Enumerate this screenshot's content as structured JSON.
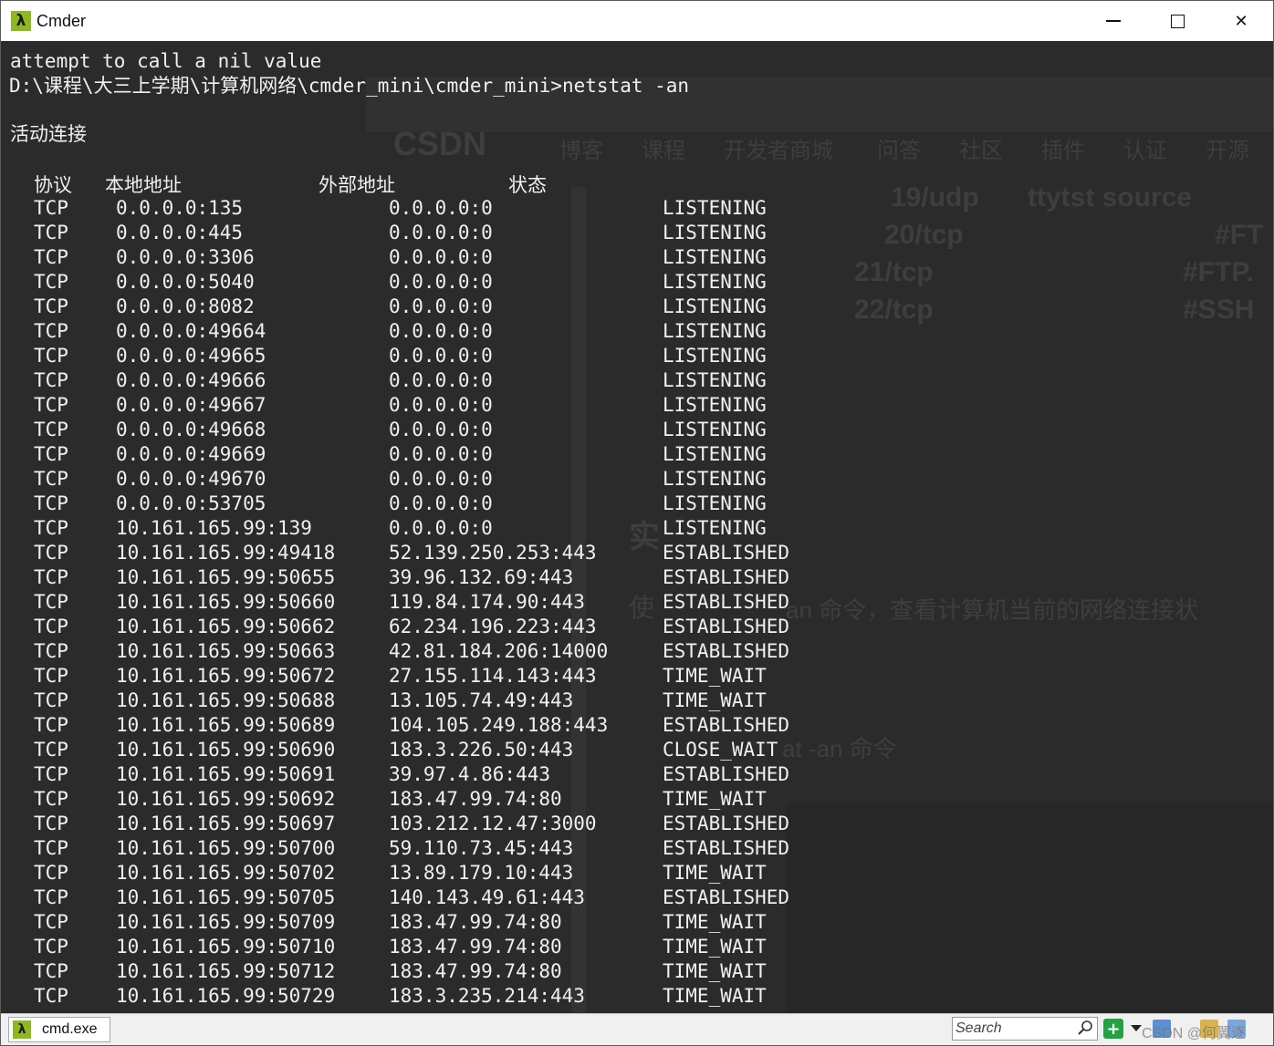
{
  "window": {
    "title": "Cmder",
    "app_icon": "λ",
    "min_icon": "minimize-icon",
    "max_icon": "maximize-icon",
    "close_icon": "close-icon",
    "close_glyph": "✕"
  },
  "terminal": {
    "lines": [
      "attempt to call a nil value",
      "D:\\课程\\大三上学期\\计算机网络\\cmder_mini\\cmder_mini>netstat -an",
      "活动连接"
    ],
    "headers": [
      "协议",
      "本地地址",
      "外部地址",
      "状态"
    ],
    "rows": [
      [
        "TCP",
        "0.0.0.0:135",
        "0.0.0.0:0",
        "LISTENING"
      ],
      [
        "TCP",
        "0.0.0.0:445",
        "0.0.0.0:0",
        "LISTENING"
      ],
      [
        "TCP",
        "0.0.0.0:3306",
        "0.0.0.0:0",
        "LISTENING"
      ],
      [
        "TCP",
        "0.0.0.0:5040",
        "0.0.0.0:0",
        "LISTENING"
      ],
      [
        "TCP",
        "0.0.0.0:8082",
        "0.0.0.0:0",
        "LISTENING"
      ],
      [
        "TCP",
        "0.0.0.0:49664",
        "0.0.0.0:0",
        "LISTENING"
      ],
      [
        "TCP",
        "0.0.0.0:49665",
        "0.0.0.0:0",
        "LISTENING"
      ],
      [
        "TCP",
        "0.0.0.0:49666",
        "0.0.0.0:0",
        "LISTENING"
      ],
      [
        "TCP",
        "0.0.0.0:49667",
        "0.0.0.0:0",
        "LISTENING"
      ],
      [
        "TCP",
        "0.0.0.0:49668",
        "0.0.0.0:0",
        "LISTENING"
      ],
      [
        "TCP",
        "0.0.0.0:49669",
        "0.0.0.0:0",
        "LISTENING"
      ],
      [
        "TCP",
        "0.0.0.0:49670",
        "0.0.0.0:0",
        "LISTENING"
      ],
      [
        "TCP",
        "0.0.0.0:53705",
        "0.0.0.0:0",
        "LISTENING"
      ],
      [
        "TCP",
        "10.161.165.99:139",
        "0.0.0.0:0",
        "LISTENING"
      ],
      [
        "TCP",
        "10.161.165.99:49418",
        "52.139.250.253:443",
        "ESTABLISHED"
      ],
      [
        "TCP",
        "10.161.165.99:50655",
        "39.96.132.69:443",
        "ESTABLISHED"
      ],
      [
        "TCP",
        "10.161.165.99:50660",
        "119.84.174.90:443",
        "ESTABLISHED"
      ],
      [
        "TCP",
        "10.161.165.99:50662",
        "62.234.196.223:443",
        "ESTABLISHED"
      ],
      [
        "TCP",
        "10.161.165.99:50663",
        "42.81.184.206:14000",
        "ESTABLISHED"
      ],
      [
        "TCP",
        "10.161.165.99:50672",
        "27.155.114.143:443",
        "TIME_WAIT"
      ],
      [
        "TCP",
        "10.161.165.99:50688",
        "13.105.74.49:443",
        "TIME_WAIT"
      ],
      [
        "TCP",
        "10.161.165.99:50689",
        "104.105.249.188:443",
        "ESTABLISHED"
      ],
      [
        "TCP",
        "10.161.165.99:50690",
        "183.3.226.50:443",
        "CLOSE_WAIT"
      ],
      [
        "TCP",
        "10.161.165.99:50691",
        "39.97.4.86:443",
        "ESTABLISHED"
      ],
      [
        "TCP",
        "10.161.165.99:50692",
        "183.47.99.74:80",
        "TIME_WAIT"
      ],
      [
        "TCP",
        "10.161.165.99:50697",
        "103.212.12.47:3000",
        "ESTABLISHED"
      ],
      [
        "TCP",
        "10.161.165.99:50700",
        "59.110.73.45:443",
        "ESTABLISHED"
      ],
      [
        "TCP",
        "10.161.165.99:50702",
        "13.89.179.10:443",
        "TIME_WAIT"
      ],
      [
        "TCP",
        "10.161.165.99:50705",
        "140.143.49.61:443",
        "ESTABLISHED"
      ],
      [
        "TCP",
        "10.161.165.99:50709",
        "183.47.99.74:80",
        "TIME_WAIT"
      ],
      [
        "TCP",
        "10.161.165.99:50710",
        "183.47.99.74:80",
        "TIME_WAIT"
      ],
      [
        "TCP",
        "10.161.165.99:50712",
        "183.47.99.74:80",
        "TIME_WAIT"
      ],
      [
        "TCP",
        "10.161.165.99:50729",
        "183.3.235.214:443",
        "TIME_WAIT"
      ]
    ],
    "background_ghost": {
      "brand": "CSDN",
      "nav": [
        "博客",
        "课程",
        "开发者商城",
        "问答",
        "社区",
        "插件",
        "认证",
        "开源"
      ],
      "ports": [
        "19/udp",
        "20/tcp",
        "21/tcp",
        "22/tcp"
      ],
      "port_notes": [
        "ttytst source",
        "#FT",
        "#FTP.",
        "#SSH"
      ],
      "misc": [
        "实",
        "使",
        "an 命令，查看计算机当前的网络连接状",
        "at -an 命令"
      ]
    }
  },
  "statusbar": {
    "tab_label": "cmd.exe",
    "tab_icon": "λ",
    "search_placeholder": "Search",
    "search_icon": "search-icon",
    "add_icon": "plus-icon",
    "add_glyph": "+",
    "watermark": "CSDN @何翼逐"
  },
  "colors": {
    "terminal_bg": "#2b2b2b",
    "terminal_fg": "#f0f0f0",
    "accent_green": "#8fb820"
  }
}
